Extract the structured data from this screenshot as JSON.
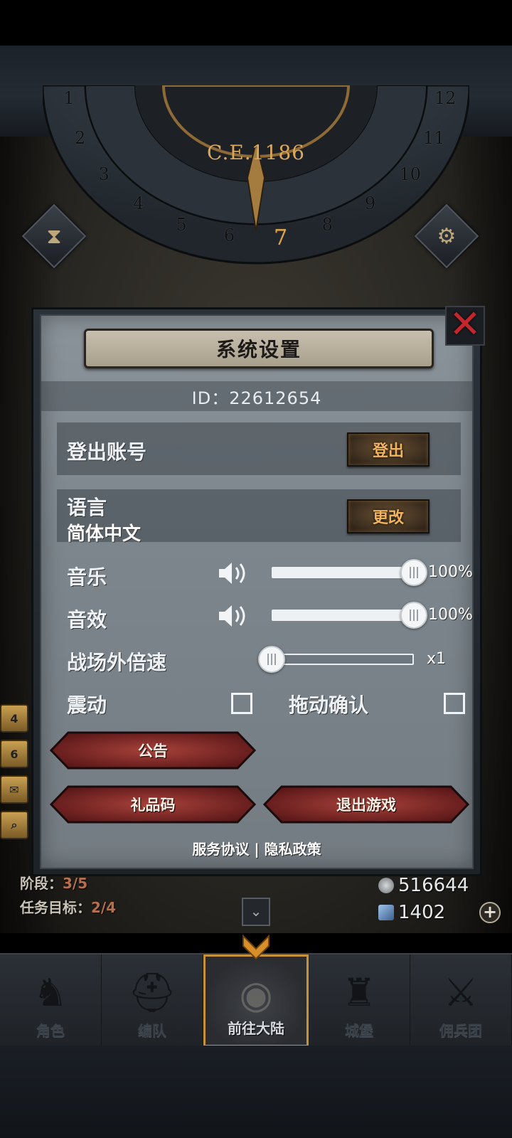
{
  "header": {
    "era": "C.E.1186",
    "months": [
      "1",
      "2",
      "3",
      "4",
      "5",
      "6",
      "7",
      "8",
      "9",
      "10",
      "11",
      "12"
    ],
    "active_month": "7",
    "left_button_icon": "hourglass-icon",
    "right_button_icon": "gear-icon"
  },
  "dialog": {
    "title": "系统设置",
    "close_icon": "close-icon",
    "id_text": "ID：22612654",
    "logout": {
      "label": "登出账号",
      "button": "登出"
    },
    "language": {
      "label": "语言",
      "value": "简体中文",
      "button": "更改"
    },
    "music": {
      "label": "音乐",
      "value_text": "100%",
      "level": 1.0,
      "icon": "speaker-icon"
    },
    "sfx": {
      "label": "音效",
      "value_text": "100%",
      "level": 1.0,
      "icon": "speaker-icon"
    },
    "speed": {
      "label": "战场外倍速",
      "value_text": "x1",
      "level": 0.0
    },
    "vibration": {
      "label": "震动",
      "checked": false
    },
    "drag_confirm": {
      "label": "拖动确认",
      "checked": false
    },
    "buttons": {
      "notice": "公告",
      "gift_code": "礼品码",
      "exit_game": "退出游戏"
    },
    "links": {
      "service": "服务协议",
      "separator": "|",
      "privacy": "隐私政策"
    }
  },
  "hud": {
    "stage_label": "阶段",
    "stage_value": "3/5",
    "quest_label": "任务目标",
    "quest_value": "2/4",
    "silver": "516644",
    "crystal": "1402",
    "side_badges": [
      "4",
      "6"
    ]
  },
  "nav": {
    "items": [
      {
        "label": "角色",
        "icon": "knight-icon"
      },
      {
        "label": "编队",
        "icon": "helmet-icon"
      },
      {
        "label": "前往大陆",
        "icon": "globe-icon",
        "active": true
      },
      {
        "label": "城堡",
        "icon": "castle-icon"
      },
      {
        "label": "佣兵团",
        "icon": "swords-icon"
      }
    ]
  },
  "colors": {
    "accent_gold": "#e2a842",
    "close_red": "#c5262c",
    "button_red": "#7a1f1f",
    "panel_grey": "#838c93"
  }
}
